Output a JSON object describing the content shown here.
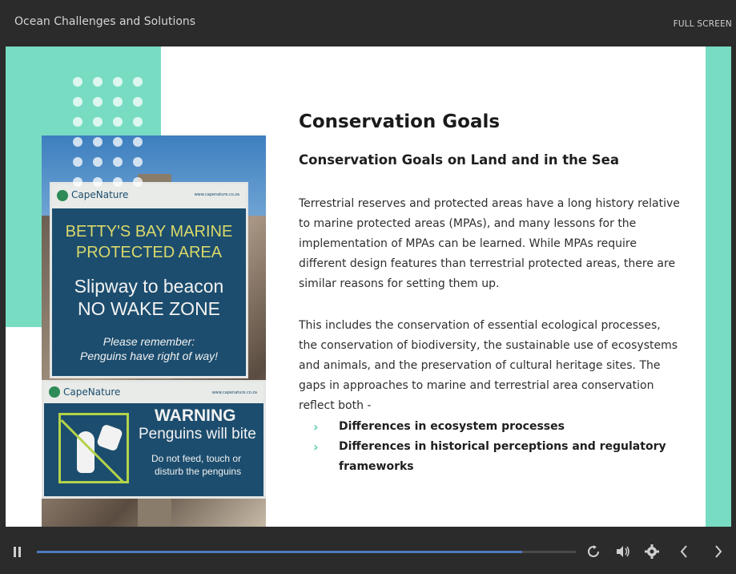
{
  "header": {
    "course_title": "Ocean Challenges and Solutions",
    "fullscreen_label": "FULL SCREEN"
  },
  "slide": {
    "heading": "Conservation Goals",
    "subheading": "Conservation Goals on Land and in the Sea",
    "paragraph1": "Terrestrial reserves and protected areas have a long history relative to marine protected areas (MPAs), and many lessons for the implementation of MPAs can be learned. While MPAs require different design features than terrestrial protected areas, there are similar reasons for setting them up.",
    "paragraph2": "This includes the conservation of essential ecological processes, the conservation of biodiversity, the sustainable use of ecosystems and animals, and the preservation of cultural heritage sites. The gaps in approaches to marine and terrestrial area conservation reflect both -",
    "bullets": [
      "Differences in ecosystem processes",
      "Differences in historical perceptions and regulatory frameworks"
    ],
    "accent_color": "#78dcc3"
  },
  "photo": {
    "sign1": {
      "logo": "CapeNature",
      "url": "www.capenature.co.za",
      "line1": "BETTY'S BAY MARINE",
      "line2": "PROTECTED AREA",
      "line3": "Slipway to beacon",
      "line4": "NO WAKE ZONE",
      "line5": "Please remember:",
      "line6": "Penguins have right of way!"
    },
    "sign2": {
      "logo": "CapeNature",
      "url": "www.capenature.co.za",
      "line1": "WARNING",
      "line2": "Penguins will bite",
      "line3": "Do not feed, touch or",
      "line4": "disturb the penguins"
    }
  },
  "controls": {
    "progress_fraction": 0.9,
    "icons": [
      "pause-icon",
      "replay-icon",
      "volume-icon",
      "settings-icon",
      "previous-icon",
      "next-icon"
    ]
  }
}
